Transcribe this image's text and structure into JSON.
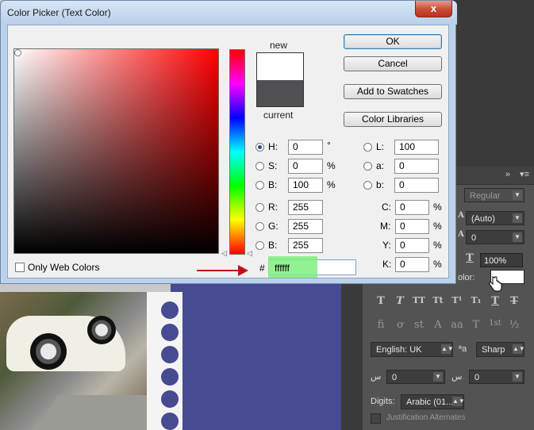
{
  "dialog": {
    "title": "Color Picker (Text Color)",
    "close_glyph": "x",
    "new_label": "new",
    "current_label": "current",
    "new_color": "#ffffff",
    "current_color": "#505054",
    "buttons": {
      "ok": "OK",
      "cancel": "Cancel",
      "add_swatches": "Add to Swatches",
      "color_libraries": "Color Libraries"
    },
    "hsb": [
      {
        "label": "H:",
        "value": "0",
        "unit": "°",
        "selected": true
      },
      {
        "label": "S:",
        "value": "0",
        "unit": "%",
        "selected": false
      },
      {
        "label": "B:",
        "value": "100",
        "unit": "%",
        "selected": false
      }
    ],
    "rgb": [
      {
        "label": "R:",
        "value": "255"
      },
      {
        "label": "G:",
        "value": "255"
      },
      {
        "label": "B:",
        "value": "255"
      }
    ],
    "lab": [
      {
        "label": "L:",
        "value": "100"
      },
      {
        "label": "a:",
        "value": "0"
      },
      {
        "label": "b:",
        "value": "0"
      }
    ],
    "cmyk": [
      {
        "label": "C:",
        "value": "0",
        "unit": "%"
      },
      {
        "label": "M:",
        "value": "0",
        "unit": "%"
      },
      {
        "label": "Y:",
        "value": "0",
        "unit": "%"
      },
      {
        "label": "K:",
        "value": "0",
        "unit": "%"
      }
    ],
    "hex_prefix": "#",
    "hex_value": "ffffff",
    "only_web_colors": "Only Web Colors"
  },
  "char_panel": {
    "header_chevron": "»",
    "header_menu": "▾≡",
    "font_style": "Regular",
    "leading": "(Auto)",
    "tracking": "0",
    "scale": "100%",
    "color_label": "olor:",
    "style_buttons": [
      "T",
      "T",
      "TT",
      "Tt",
      "T¹",
      "T₁",
      "T",
      "T"
    ],
    "opentype_buttons": [
      "fi",
      "ơ",
      "st",
      "A",
      "aa",
      "T",
      "1st",
      "½"
    ],
    "language": "English: UK",
    "aa_icon": "ªa",
    "antialias": "Sharp",
    "kashida_left": "0",
    "kashida_right": "0",
    "digits_label": "Digits:",
    "digits_value": "Arabic (01...",
    "justification": "Justification Alternates",
    "accent_white": "#ffffff"
  }
}
